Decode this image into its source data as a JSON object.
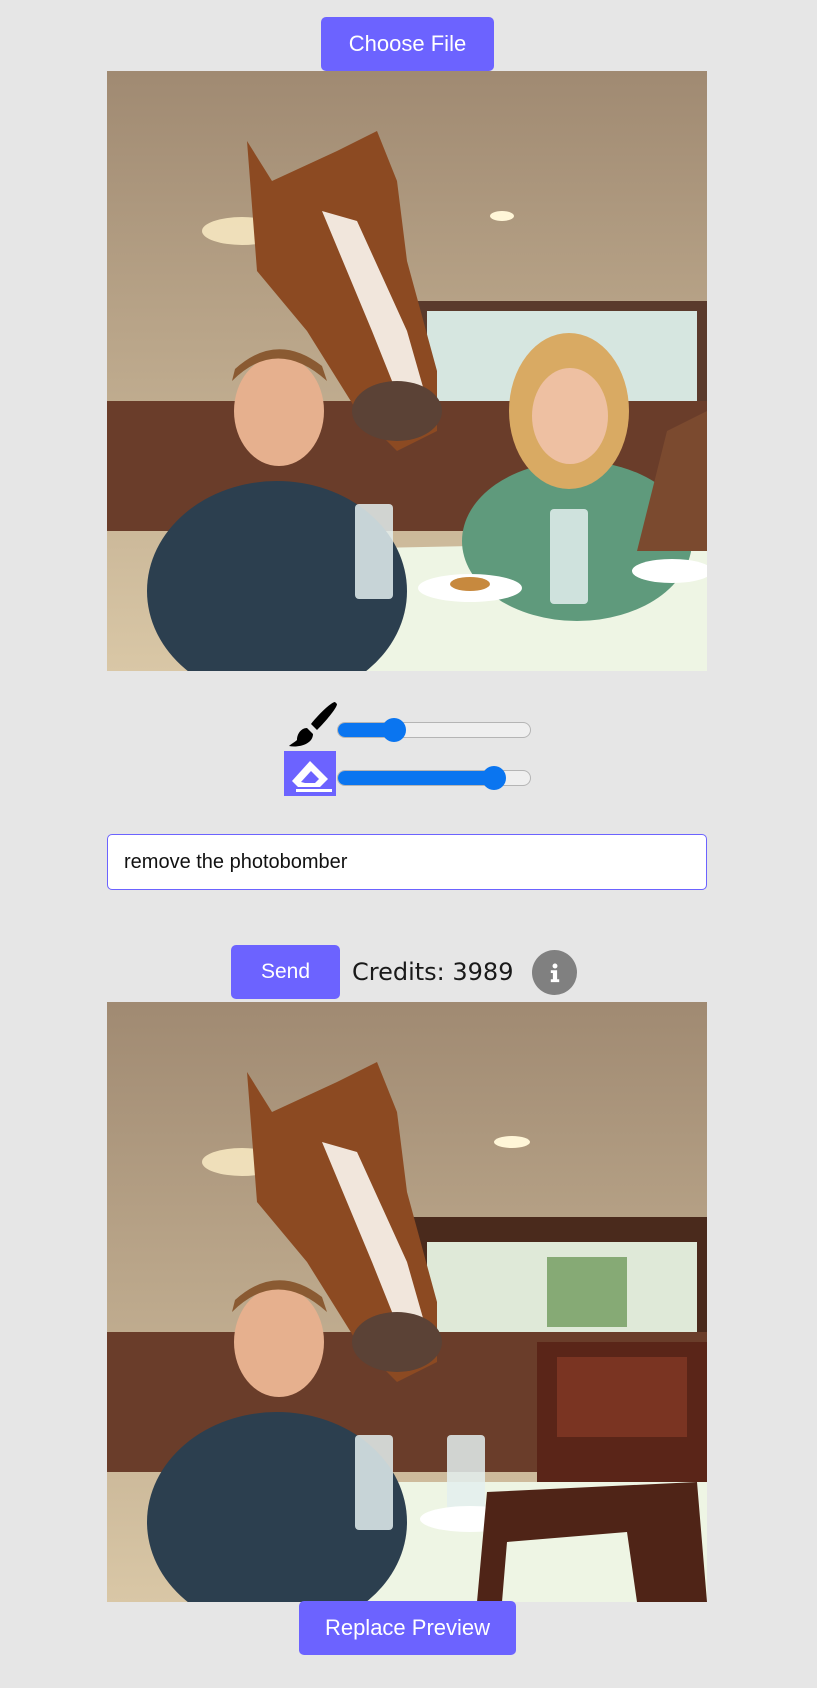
{
  "upload": {
    "choose_file_label": "Choose File"
  },
  "tools": {
    "brush": {
      "icon": "paintbrush-icon",
      "value": 0.29
    },
    "eraser": {
      "icon": "eraser-icon",
      "value": 0.81
    }
  },
  "prompt": {
    "value": "remove the photobomber"
  },
  "actions": {
    "send_label": "Send",
    "credits_text": "Credits: 3989",
    "info_icon": "info-icon"
  },
  "preview": {
    "replace_label": "Replace Preview"
  },
  "colors": {
    "accent": "#6c63ff",
    "slider": "#0a75f0",
    "background": "#e6e6e6"
  }
}
